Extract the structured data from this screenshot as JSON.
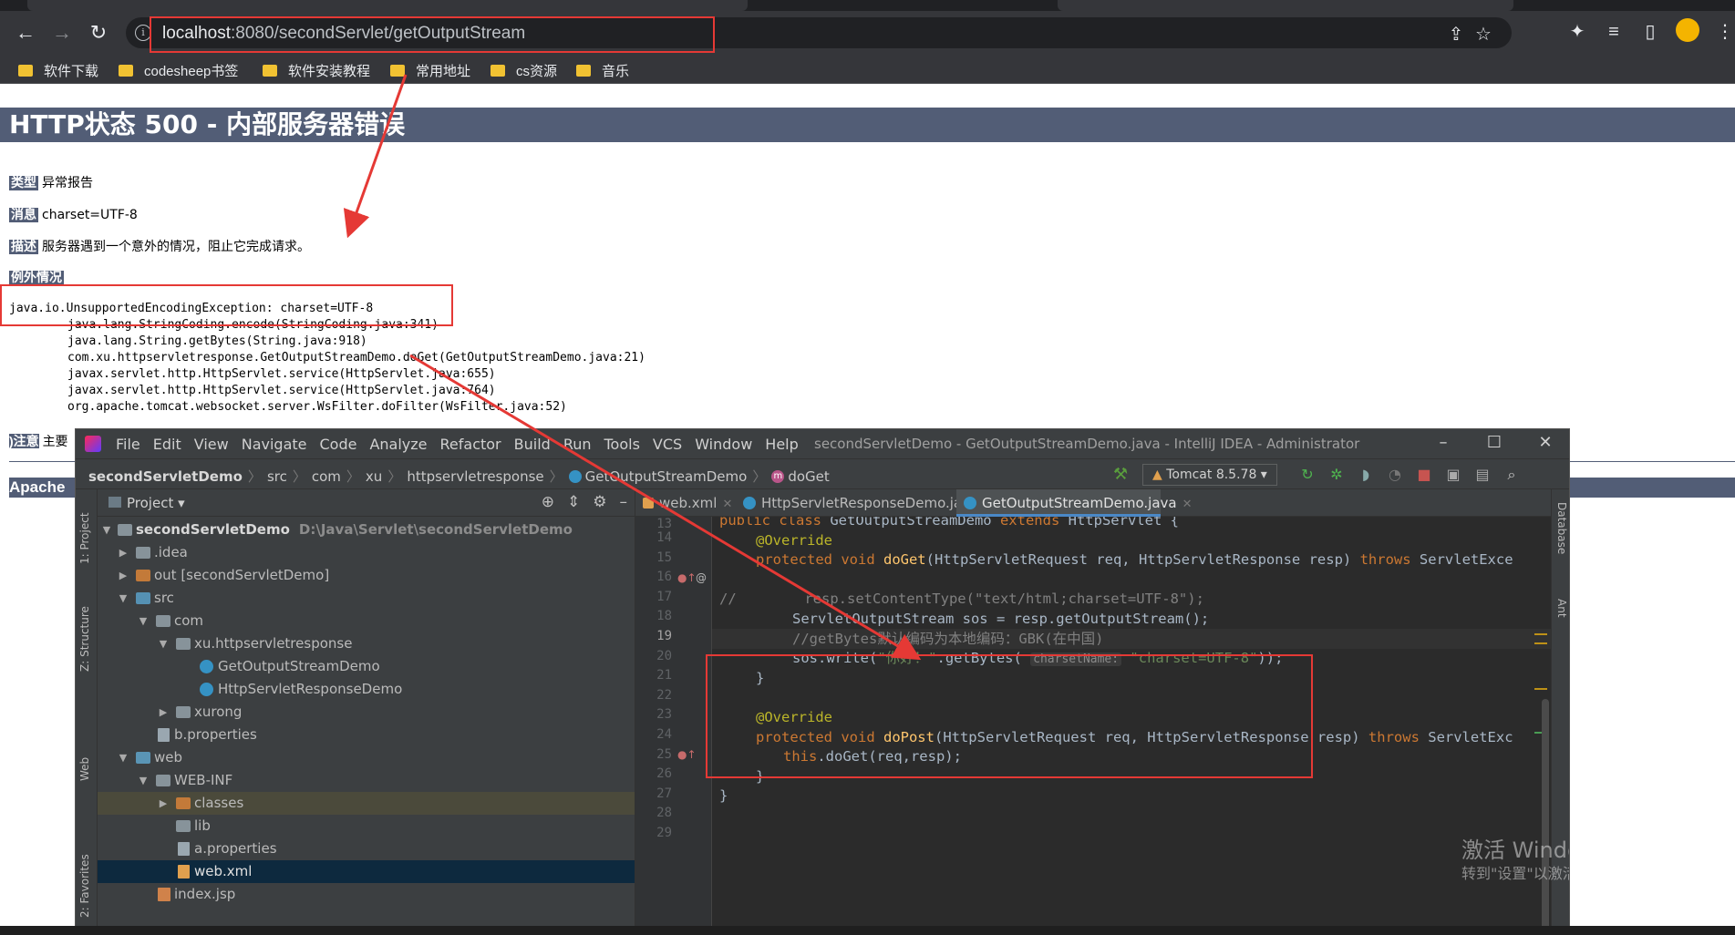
{
  "browser": {
    "url_host": "localhost",
    "url_rest": ":8080/secondServlet/getOutputStream",
    "bookmarks": [
      "软件下载",
      "codesheep书签",
      "软件安装教程",
      "常用地址",
      "cs资源",
      "音乐"
    ]
  },
  "error_page": {
    "title": "HTTP状态 500 - 内部服务器错误",
    "type_label": "类型",
    "type_value": "异常报告",
    "message_label": "消息",
    "message_value": "charset=UTF-8",
    "desc_label": "描述",
    "desc_value": "服务器遇到一个意外的情况，阻止它完成请求。",
    "exception_label": "例外情况",
    "exception_head": "java.io.UnsupportedEncodingException: charset=UTF-8",
    "stack": [
      "java.lang.StringCoding.encode(StringCoding.java:341)",
      "java.lang.String.getBytes(String.java:918)",
      "com.xu.httpservletresponse.GetOutputStreamDemo.doGet(GetOutputStreamDemo.java:21)",
      "javax.servlet.http.HttpServlet.service(HttpServlet.java:655)",
      "javax.servlet.http.HttpServlet.service(HttpServlet.java:764)",
      "org.apache.tomcat.websocket.server.WsFilter.doFilter(WsFilter.java:52)"
    ],
    "note_label": ")注意",
    "note_value": "主要",
    "footer_fragment": "Apache"
  },
  "ide": {
    "menu": [
      "File",
      "Edit",
      "View",
      "Navigate",
      "Code",
      "Analyze",
      "Refactor",
      "Build",
      "Run",
      "Tools",
      "VCS",
      "Window",
      "Help"
    ],
    "window_title": "secondServletDemo - GetOutputStreamDemo.java - IntelliJ IDEA - Administrator",
    "breadcrumbs": [
      "secondServletDemo",
      "src",
      "com",
      "xu",
      "httpservletresponse",
      "GetOutputStreamDemo",
      "doGet"
    ],
    "run_config": "Tomcat 8.5.78",
    "left_strip": [
      "1: Project",
      "Z: Structure",
      "Web",
      "2: Favorites"
    ],
    "right_strip": [
      "Database",
      "Ant"
    ],
    "project_panel_title": "Project",
    "tree": [
      {
        "label": "secondServletDemo",
        "extra": "D:\\Java\\Servlet\\secondServletDemo"
      },
      {
        "label": ".idea"
      },
      {
        "label": "out [secondServletDemo]"
      },
      {
        "label": "src"
      },
      {
        "label": "com"
      },
      {
        "label": "xu.httpservletresponse"
      },
      {
        "label": "GetOutputStreamDemo"
      },
      {
        "label": "HttpServletResponseDemo"
      },
      {
        "label": "xurong"
      },
      {
        "label": "b.properties"
      },
      {
        "label": "web"
      },
      {
        "label": "WEB-INF"
      },
      {
        "label": "classes"
      },
      {
        "label": "lib"
      },
      {
        "label": "a.properties"
      },
      {
        "label": "web.xml"
      },
      {
        "label": "index.jsp"
      }
    ],
    "tabs": [
      "web.xml",
      "HttpServletResponseDemo.java",
      "GetOutputStreamDemo.java"
    ],
    "line_numbers": [
      "13",
      "14",
      "15",
      "16",
      "17",
      "18",
      "19",
      "20",
      "21",
      "22",
      "23",
      "24",
      "25",
      "26",
      "27",
      "28",
      "29"
    ],
    "code": {
      "l14a": "public class ",
      "l14b": "GetOutputStreamDemo ",
      "l14c": "extends ",
      "l14d": "HttpServlet {",
      "l15": "@Override",
      "l16a": "protected void ",
      "l16b": "doGet",
      "l16c": "(HttpServletRequest req, HttpServletResponse resp) ",
      "l16d": "throws ",
      "l16e": "ServletExce",
      "l18a": "//",
      "l18b": "        resp.setContentType(\"text/html;charset=UTF-8\");",
      "l19": "ServletOutputStream sos = resp.getOutputStream();",
      "l20": "//getBytes默认编码为本地编码：GBK(在中国)",
      "l21a": "sos.write(",
      "l21b": "\"你好！\"",
      "l21c": ".getBytes( ",
      "l21hint": "charsetName:",
      "l21d": "\"charset=UTF-8\"",
      "l21e": "));",
      "l22": "}",
      "l24": "@Override",
      "l25a": "protected void ",
      "l25b": "doPost",
      "l25c": "(HttpServletRequest req, HttpServletResponse resp) ",
      "l25d": "throws ",
      "l25e": "ServletExc",
      "l26a": "this",
      "l26b": ".doGet(req,resp);",
      "l27": "}",
      "l28": "}"
    }
  },
  "watermark": {
    "line1": "激活 Windows",
    "line2": "转到\"设置\"以激活 Windows。"
  },
  "colors": {
    "annotation_red": "#e53935",
    "tomcat_header": "#525d76",
    "ide_background": "#2b2b2b"
  }
}
